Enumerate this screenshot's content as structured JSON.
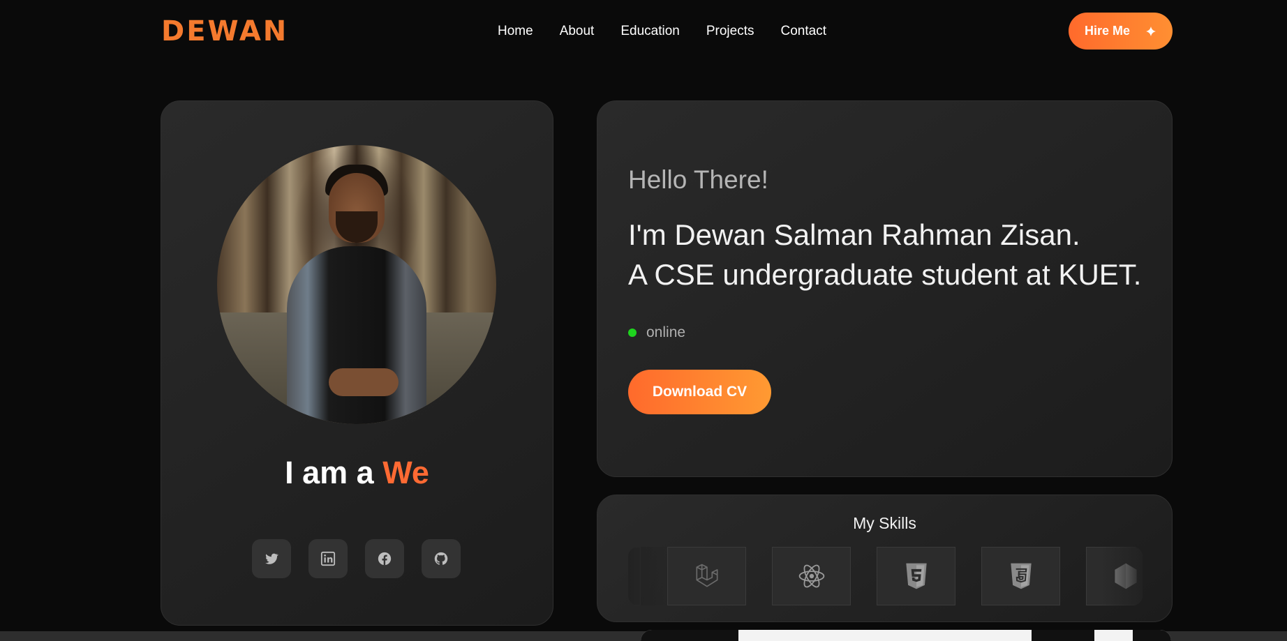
{
  "header": {
    "logo": "DEWAN",
    "nav": [
      "Home",
      "About",
      "Education",
      "Projects",
      "Contact"
    ],
    "hire_label": "Hire Me",
    "hire_icon": "sparkle-icon"
  },
  "colors": {
    "accent": "#ff6a33",
    "online": "#1ed31e",
    "background": "#0a0a0a"
  },
  "profile": {
    "iam_prefix": "I am a",
    "iam_typed": "We",
    "socials": [
      "twitter-icon",
      "linkedin-icon",
      "facebook-icon",
      "github-icon"
    ]
  },
  "intro": {
    "greeting": "Hello There!",
    "line1": "I'm Dewan Salman Rahman Zisan.",
    "line2": "A CSE undergraduate student at KUET.",
    "status": "online",
    "cv_label": "Download CV"
  },
  "skills": {
    "title": "My Skills",
    "items": [
      "laravel-icon",
      "react-icon",
      "html5-icon",
      "css3-icon",
      "nodejs-icon"
    ]
  }
}
